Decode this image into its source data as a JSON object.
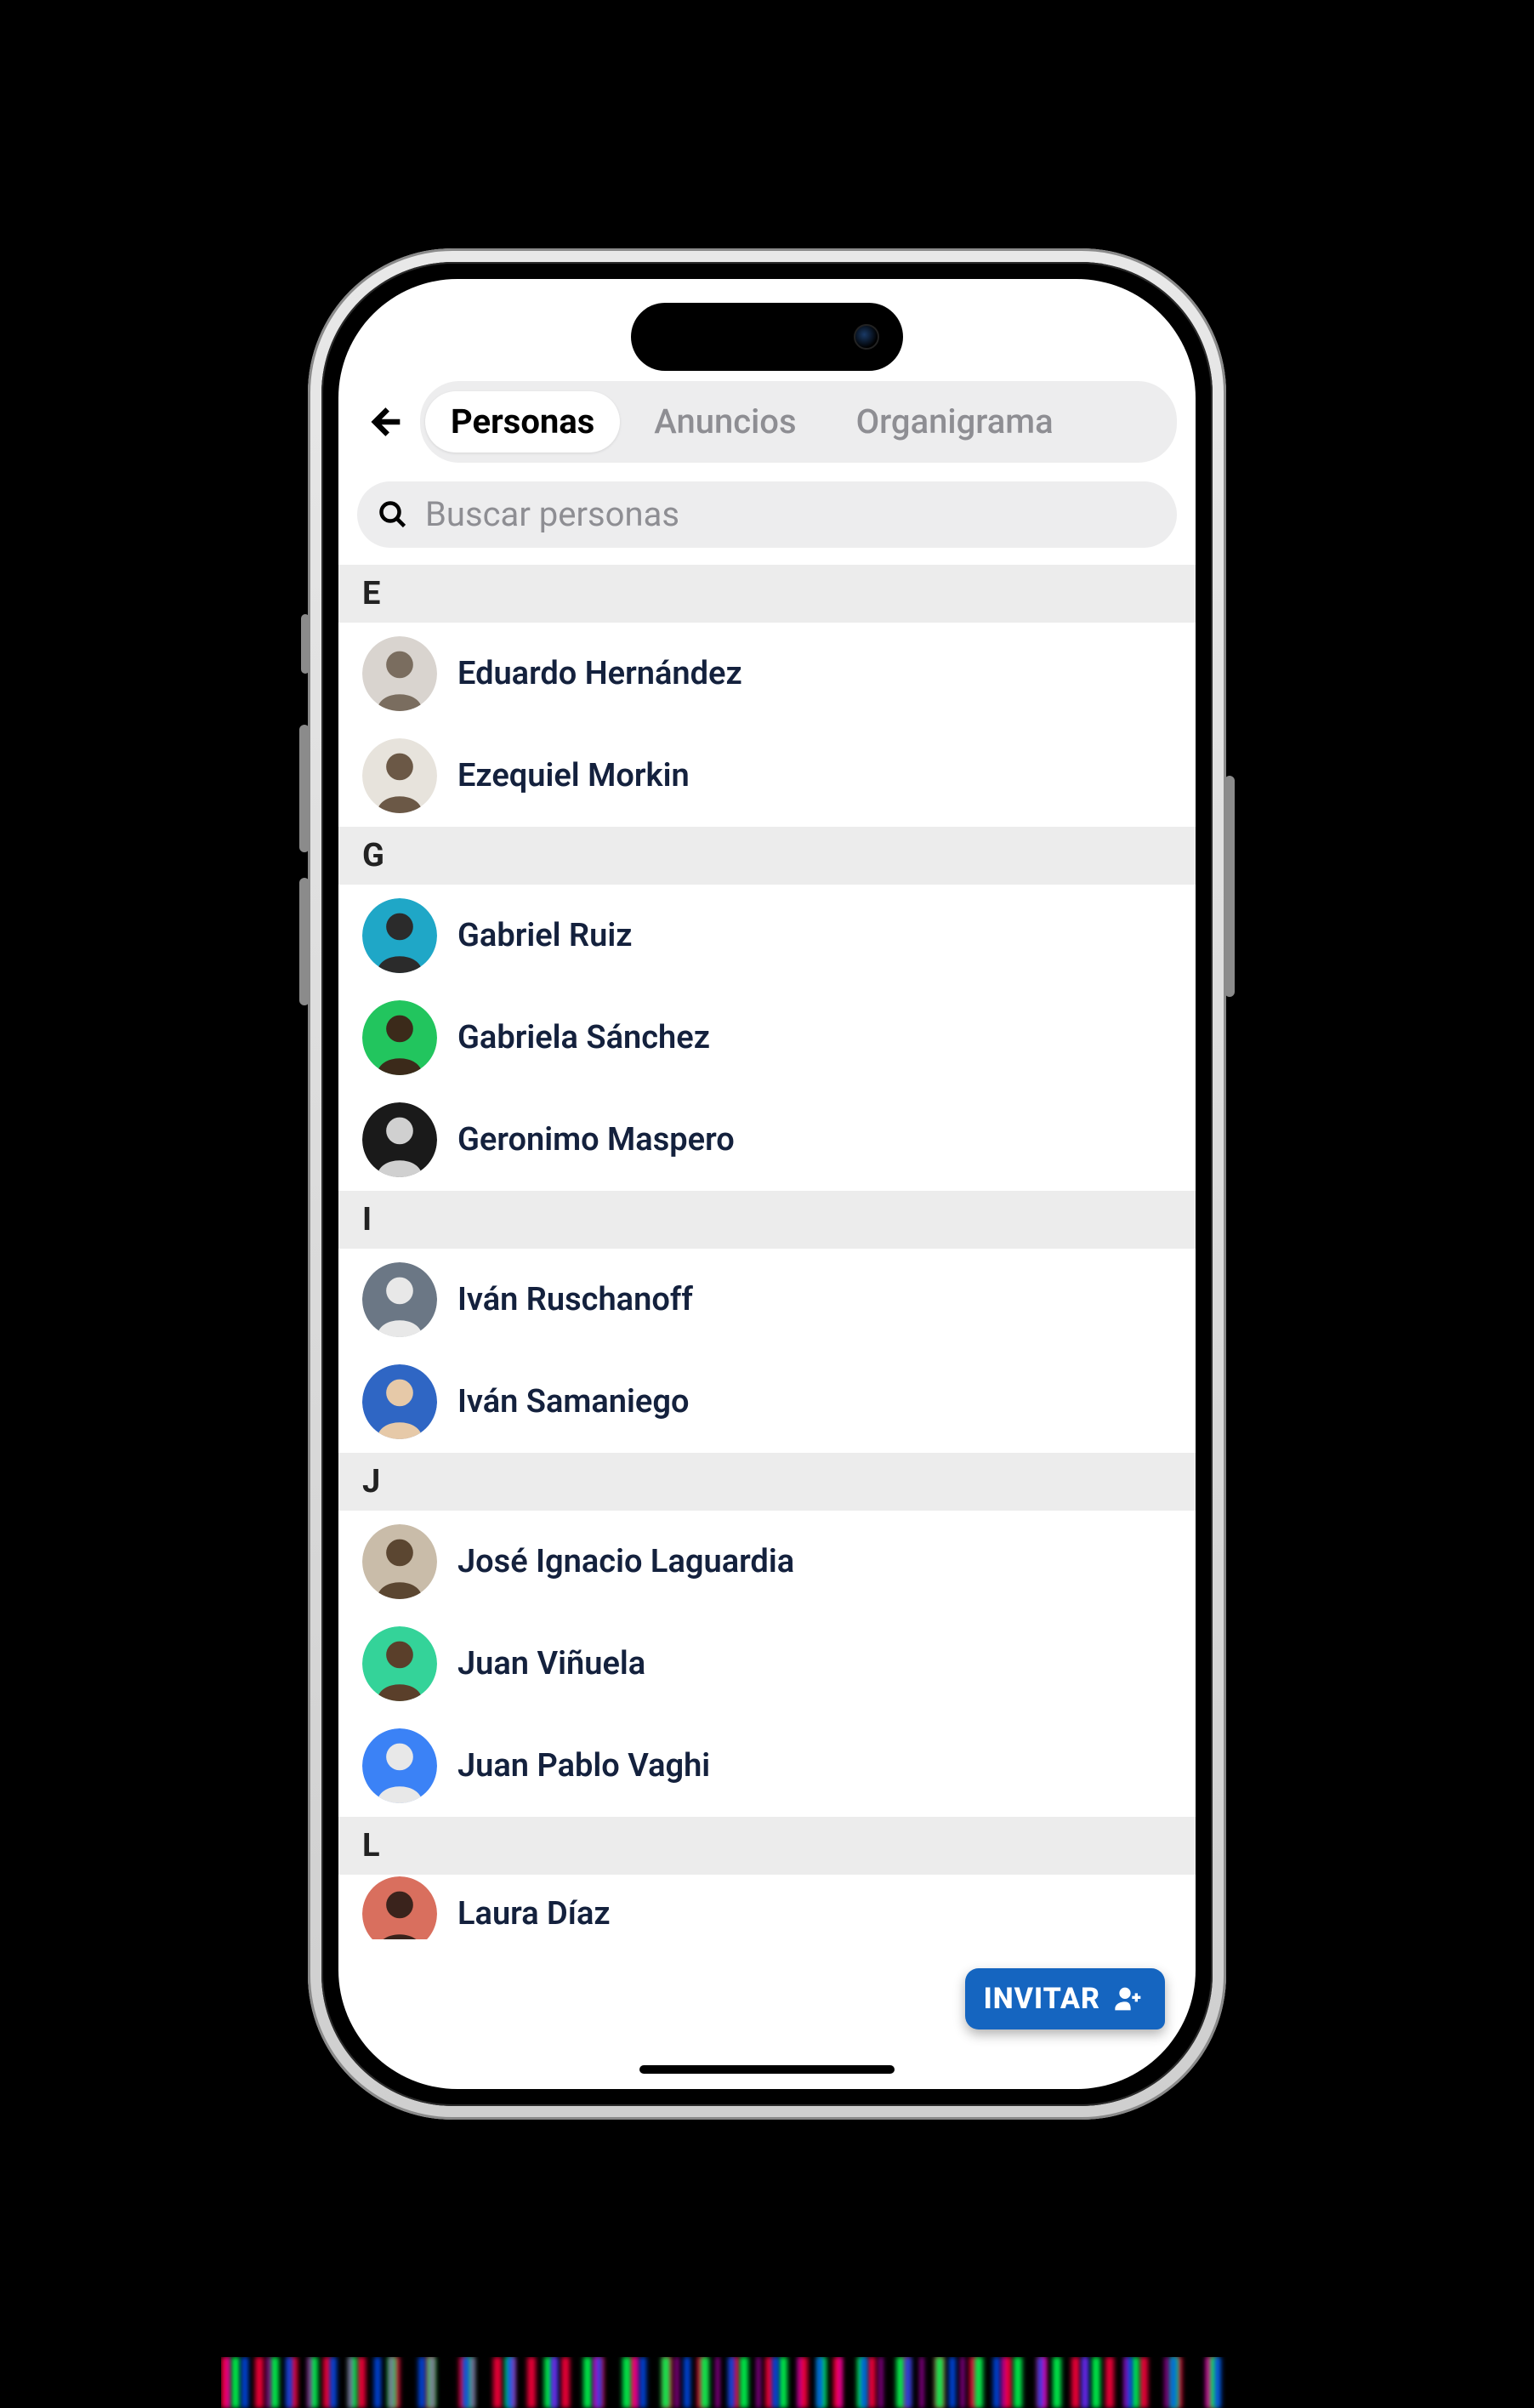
{
  "tabs": {
    "items": [
      "Personas",
      "Anuncios",
      "Organigrama"
    ],
    "active_index": 0
  },
  "search": {
    "placeholder": "Buscar personas"
  },
  "invite_label": "INVITAR",
  "sections": [
    {
      "letter": "E",
      "people": [
        {
          "name": "Eduardo Hernández",
          "avatar_bg": "#d9d4cf",
          "avatar_fg": "#7a6d5f"
        },
        {
          "name": "Ezequiel Morkin",
          "avatar_bg": "#e7e3dc",
          "avatar_fg": "#6b5846"
        }
      ]
    },
    {
      "letter": "G",
      "people": [
        {
          "name": "Gabriel Ruiz",
          "avatar_bg": "#1fa7c7",
          "avatar_fg": "#2b2b2b"
        },
        {
          "name": "Gabriela Sánchez",
          "avatar_bg": "#22c55e",
          "avatar_fg": "#3b2a1a"
        },
        {
          "name": "Geronimo Maspero",
          "avatar_bg": "#1a1a1a",
          "avatar_fg": "#d0d0d0"
        }
      ]
    },
    {
      "letter": "I",
      "people": [
        {
          "name": "Iván Ruschanoff",
          "avatar_bg": "#6b7785",
          "avatar_fg": "#e8e8e8"
        },
        {
          "name": "Iván Samaniego",
          "avatar_bg": "#2f66c4",
          "avatar_fg": "#e6c9a8"
        }
      ]
    },
    {
      "letter": "J",
      "people": [
        {
          "name": "José Ignacio Laguardia",
          "avatar_bg": "#c9bca9",
          "avatar_fg": "#5b4631"
        },
        {
          "name": "Juan Viñuela",
          "avatar_bg": "#34d399",
          "avatar_fg": "#5a3f2a"
        },
        {
          "name": "Juan Pablo Vaghi",
          "avatar_bg": "#3b82f6",
          "avatar_fg": "#e8e8e8"
        }
      ]
    },
    {
      "letter": "L",
      "people": [
        {
          "name": "Laura Díaz",
          "avatar_bg": "#d96f5e",
          "avatar_fg": "#3a231c",
          "cut": true
        }
      ]
    }
  ]
}
